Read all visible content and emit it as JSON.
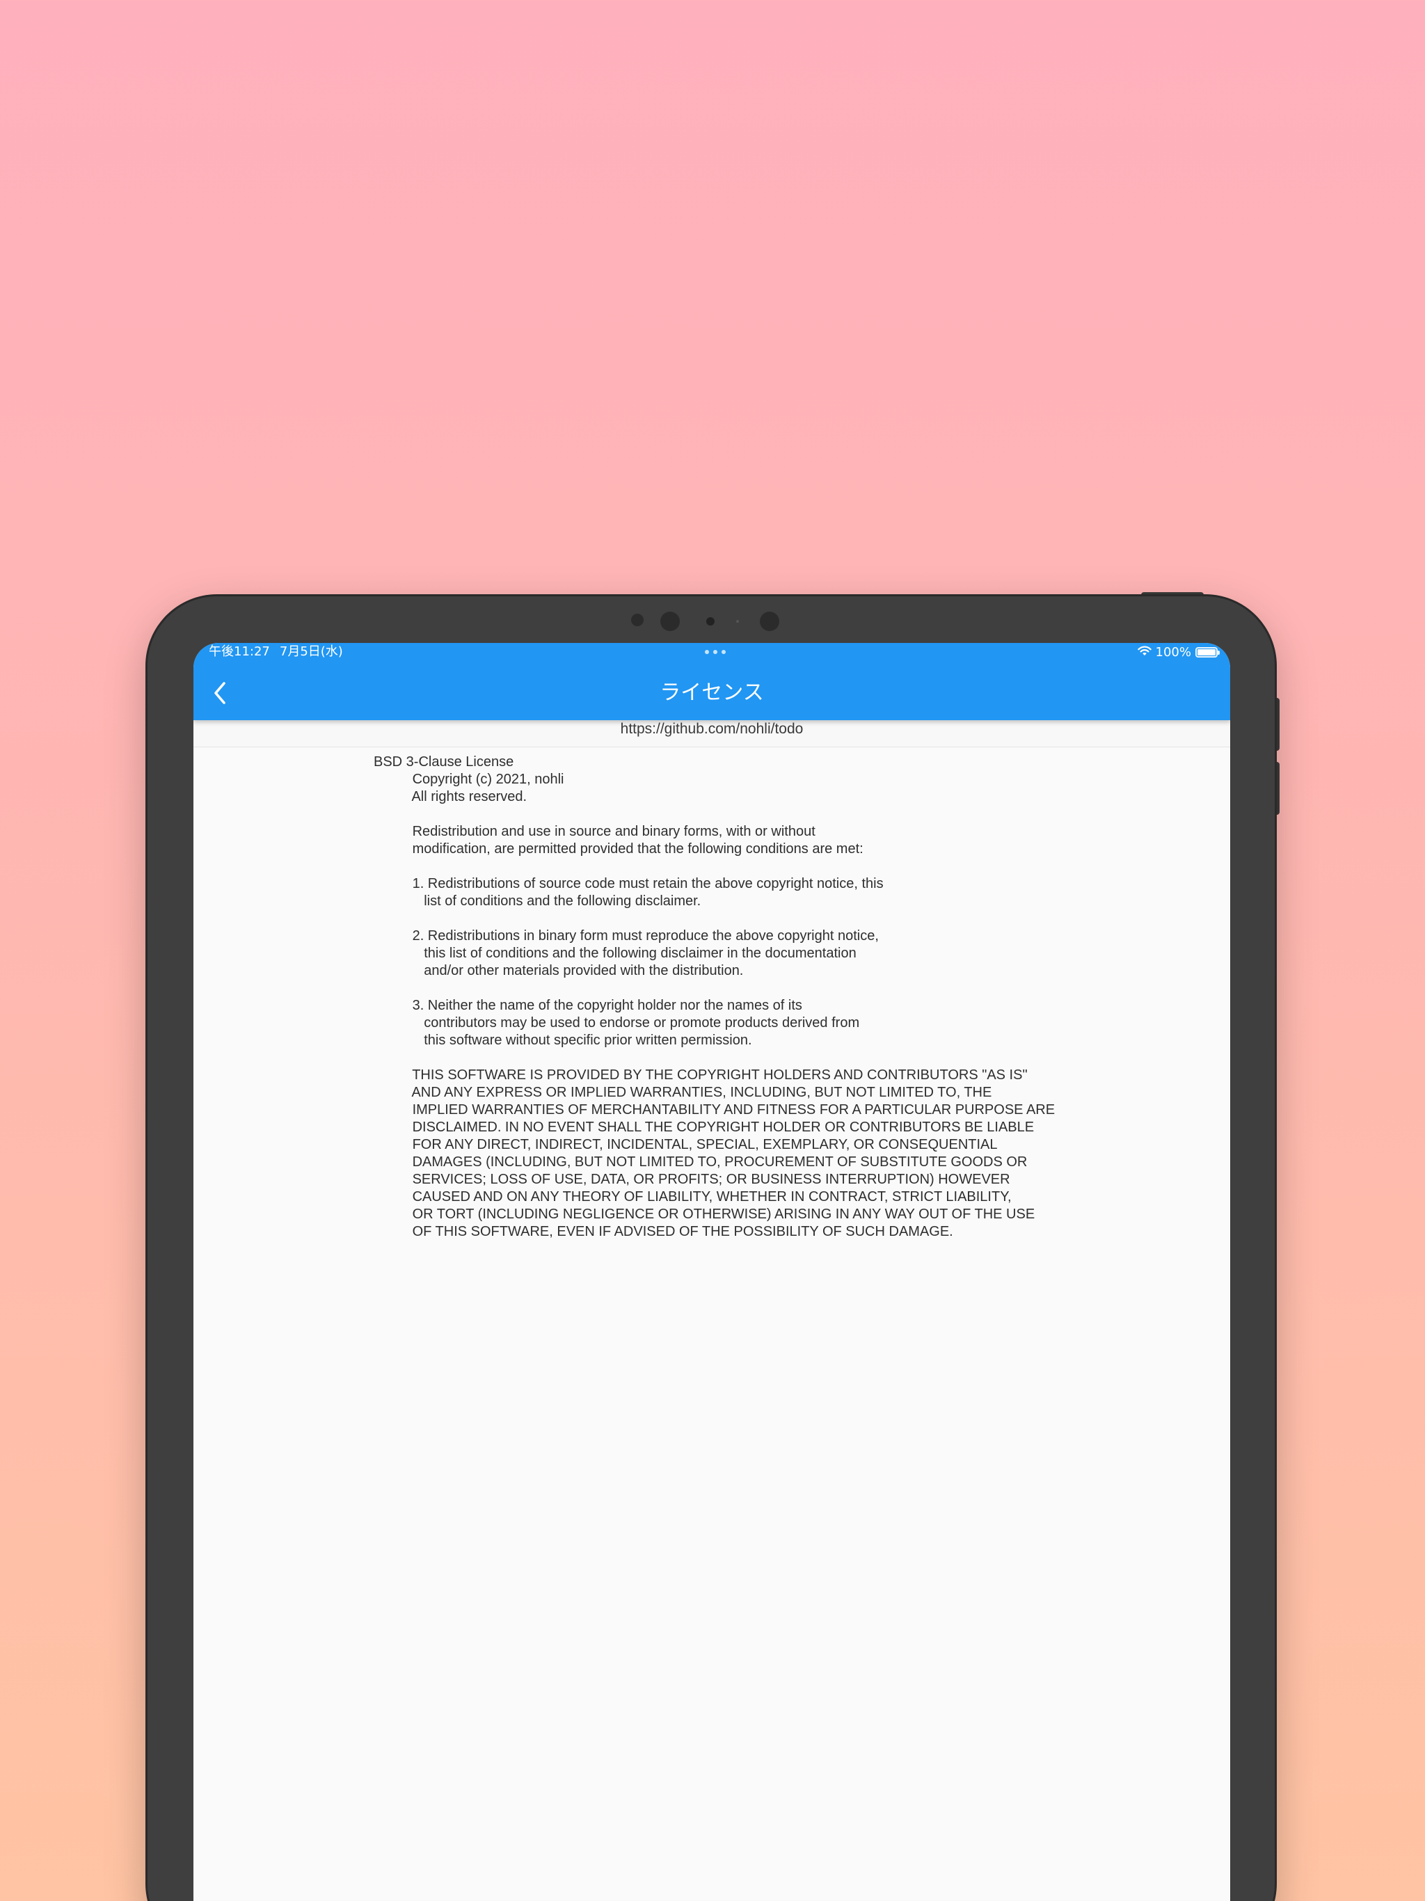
{
  "status_bar": {
    "time": "午後11:27",
    "date": "7月5日(水)",
    "battery": "100%"
  },
  "appbar": {
    "title": "ライセンス",
    "color": "#2196f3"
  },
  "url": "https://github.com/nohli/todo",
  "license": {
    "heading": "BSD 3-Clause License",
    "body": "\n          Copyright (c) 2021, nohli\n          All rights reserved.\n\n          Redistribution and use in source and binary forms, with or without\n          modification, are permitted provided that the following conditions are met:\n\n          1. Redistributions of source code must retain the above copyright notice, this\n             list of conditions and the following disclaimer.\n\n          2. Redistributions in binary form must reproduce the above copyright notice,\n             this list of conditions and the following disclaimer in the documentation\n             and/or other materials provided with the distribution.\n\n          3. Neither the name of the copyright holder nor the names of its\n             contributors may be used to endorse or promote products derived from\n             this software without specific prior written permission.\n\n          THIS SOFTWARE IS PROVIDED BY THE COPYRIGHT HOLDERS AND CONTRIBUTORS \"AS IS\"\n          AND ANY EXPRESS OR IMPLIED WARRANTIES, INCLUDING, BUT NOT LIMITED TO, THE\n          IMPLIED WARRANTIES OF MERCHANTABILITY AND FITNESS FOR A PARTICULAR PURPOSE ARE\n          DISCLAIMED. IN NO EVENT SHALL THE COPYRIGHT HOLDER OR CONTRIBUTORS BE LIABLE\n          FOR ANY DIRECT, INDIRECT, INCIDENTAL, SPECIAL, EXEMPLARY, OR CONSEQUENTIAL\n          DAMAGES (INCLUDING, BUT NOT LIMITED TO, PROCUREMENT OF SUBSTITUTE GOODS OR\n          SERVICES; LOSS OF USE, DATA, OR PROFITS; OR BUSINESS INTERRUPTION) HOWEVER\n          CAUSED AND ON ANY THEORY OF LIABILITY, WHETHER IN CONTRACT, STRICT LIABILITY,\n          OR TORT (INCLUDING NEGLIGENCE OR OTHERWISE) ARISING IN ANY WAY OUT OF THE USE\n          OF THIS SOFTWARE, EVEN IF ADVISED OF THE POSSIBILITY OF SUCH DAMAGE."
  },
  "icons": {
    "back": "chevron-left-icon",
    "wifi": "wifi-icon",
    "battery": "battery-icon",
    "multitasking": "three-dots-icon"
  }
}
